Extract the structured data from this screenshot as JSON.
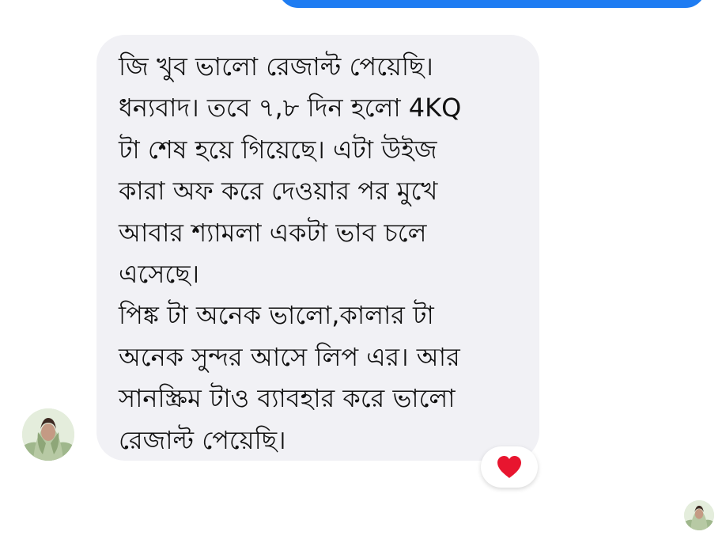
{
  "chat": {
    "incoming_message": {
      "text": "জি খুব ভালো রেজাল্ট পেয়েছি।\nধন্যবাদ। তবে ৭,৮ দিন হলো 4KQ\nটা শেষ হয়ে গিয়েছে। এটা উইজ\nকারা অফ করে দেওয়ার পর মুখে\nআবার শ্যামলা একটা ভাব চলে\nএসেছে।\nপিঙ্ক টা অনেক ভালো,কালার টা\nঅনেক সুন্দর আসে লিপ এর। আর\nসানস্ক্রিম টাও ব্যাবহার করে ভালো\nরেজাল্ট পেয়েছি।",
      "reaction": "heart-icon"
    }
  },
  "colors": {
    "sent_bubble": "#1e7cf2",
    "received_bubble": "#f1f1f5",
    "text": "#111111",
    "heart": "#e8152f",
    "background": "#ffffff"
  }
}
